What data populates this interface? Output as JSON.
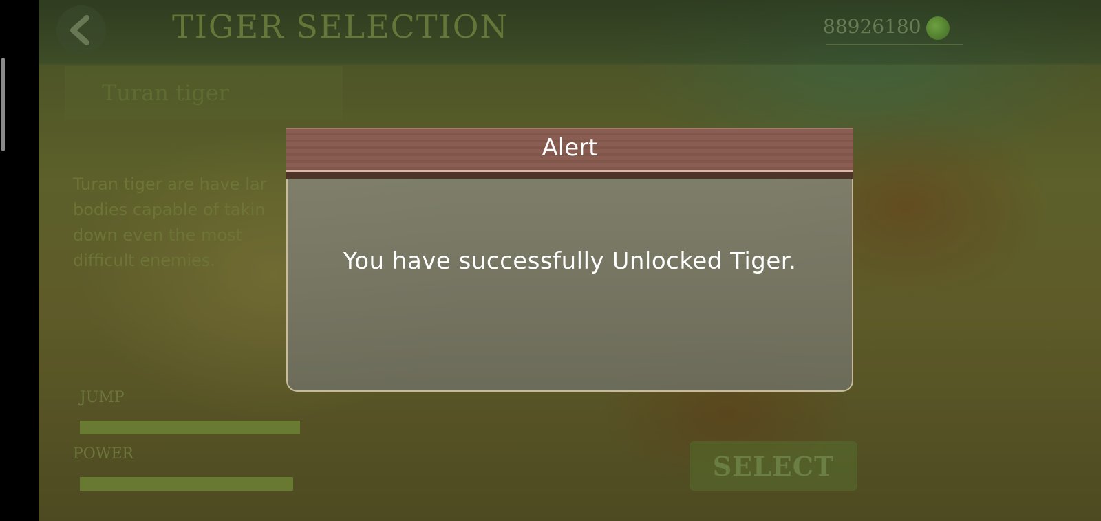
{
  "header": {
    "title": "TIGER SELECTION",
    "coins": "88926180",
    "back_icon": "chevron-left-icon",
    "coin_icon": "coin-icon"
  },
  "tiger": {
    "name": "Turan tiger",
    "description": "Turan tiger are have lar\nbodies  capable of takin\ndown even the most\ndifficult enemies.",
    "stats": {
      "jump_label": "JUMP",
      "power_label": "POWER"
    }
  },
  "select_button": {
    "label": "SELECT"
  },
  "alert": {
    "title": "Alert",
    "message": "You have successfully Unlocked Tiger."
  },
  "colors": {
    "alert_header": "#8a5d52",
    "alert_border": "#c9bb98",
    "background": "#6d7131"
  }
}
